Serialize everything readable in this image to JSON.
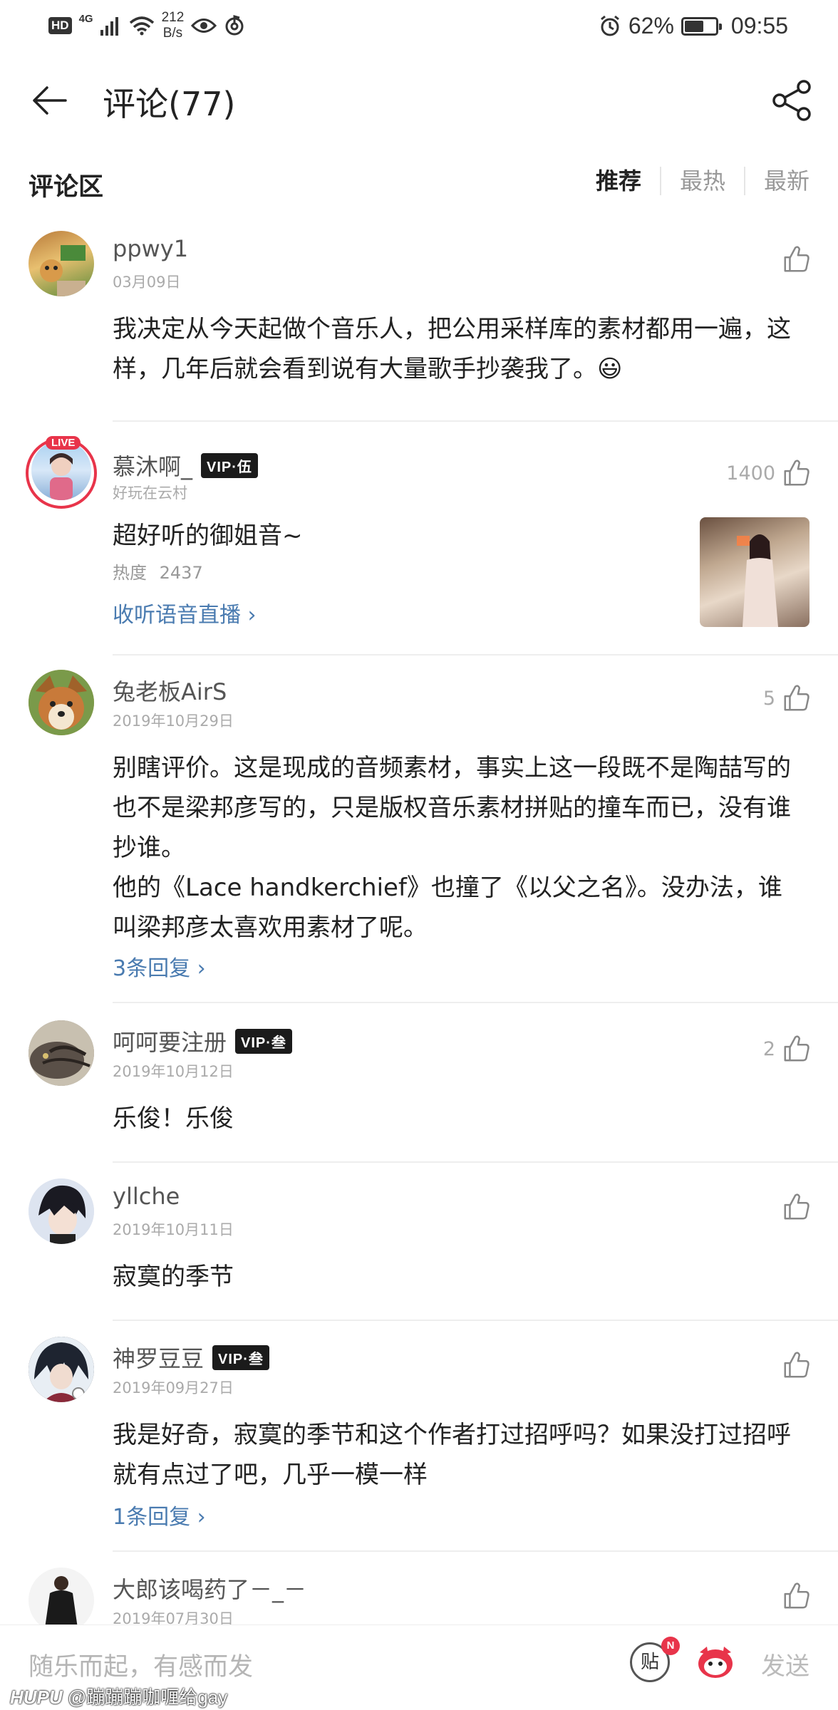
{
  "status_bar": {
    "hd": "HD",
    "network": "4G",
    "speed_value": "212",
    "speed_unit": "B/s",
    "battery_level": "62%",
    "battery_fraction": 0.62,
    "time": "09:55"
  },
  "header": {
    "title": "评论(77)",
    "back_icon": "arrow-left-icon",
    "share_icon": "share-icon"
  },
  "section": {
    "title": "评论区",
    "sort_tabs": [
      "推荐",
      "最热",
      "最新"
    ],
    "active_sort": "推荐"
  },
  "comments": [
    {
      "username": "ppwy1",
      "date": "03月09日",
      "likes": "",
      "content": "我决定从今天起做个音乐人，把公用采样库的素材都用一遍，这样，几年后就会看到说有大量歌手抄袭我了。😃",
      "reply_link": ""
    },
    {
      "username": "慕沐啊_",
      "vip": "VIP·伍",
      "live_badge": "LIVE",
      "subtitle": "好玩在云村",
      "likes": "1400",
      "content": "超好听的御姐音~",
      "hot_label": "热度",
      "hot_value": "2437",
      "action_link": "收听语音直播 ›"
    },
    {
      "username": "兔老板AirS",
      "date": "2019年10月29日",
      "likes": "5",
      "content_lines": [
        "别瞎评价。这是现成的音频素材，事实上这一段既不是陶喆写的也不是梁邦彦写的，只是版权音乐素材拼贴的撞车而已，没有谁抄谁。",
        "他的《Lace handkerchief》也撞了《以父之名》。没办法，谁叫梁邦彦太喜欢用素材了呢。"
      ],
      "reply_link": "3条回复 ›"
    },
    {
      "username": "呵呵要注册",
      "vip": "VIP·叁",
      "date": "2019年10月12日",
      "likes": "2",
      "content": "乐俊！乐俊"
    },
    {
      "username": "yllche",
      "date": "2019年10月11日",
      "likes": "",
      "content": "寂寞的季节"
    },
    {
      "username": "神罗豆豆",
      "vip": "VIP·叁",
      "date": "2019年09月27日",
      "likes": "",
      "content": "我是好奇，寂寞的季节和这个作者打过招呼吗？如果没打过招呼就有点过了吧，几乎一模一样",
      "reply_link": "1条回复 ›"
    },
    {
      "username": "大郎该喝药了－_－",
      "date": "2019年07月30日",
      "likes": ""
    }
  ],
  "bottom_bar": {
    "input_placeholder": "随乐而起，有感而发",
    "sticker_label": "贴",
    "sticker_badge": "N",
    "send_label": "发送"
  },
  "watermark": {
    "brand": "HUPU",
    "handle": "@蹦蹦蹦咖喱给gay"
  },
  "colors": {
    "link": "#4a7bb0",
    "live": "#e8344a",
    "vip_bg": "#1b1b1b"
  }
}
